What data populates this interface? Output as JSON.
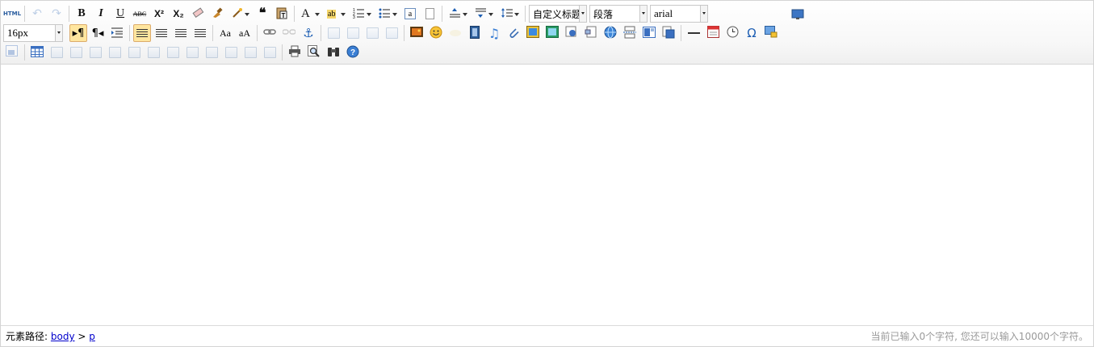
{
  "toolbar": {
    "source_label": "HTML",
    "bold_label": "B",
    "italic_label": "I",
    "underline_label": "U",
    "strike_label": "ABC",
    "superscript_label": "X²",
    "subscript_label": "X₂",
    "blockquote_label": "❝",
    "fontcolor_label": "A",
    "backcolor_label": "ab",
    "customstyle_value": "自定义标题",
    "paragraph_value": "段落",
    "fontfamily_value": "arial",
    "fontsize_value": "16px",
    "omega_label": "Ω"
  },
  "status": {
    "path_prefix": "元素路径:",
    "path_body": "body",
    "path_separator": ">",
    "path_p": "p",
    "word_count": "当前已输入0个字符, 您还可以输入10000个字符。"
  },
  "colors": {
    "active_bg": "#ffe69f",
    "active_border": "#dcac6c",
    "link": "#0000cc",
    "help_blue": "#3b7fd4"
  }
}
